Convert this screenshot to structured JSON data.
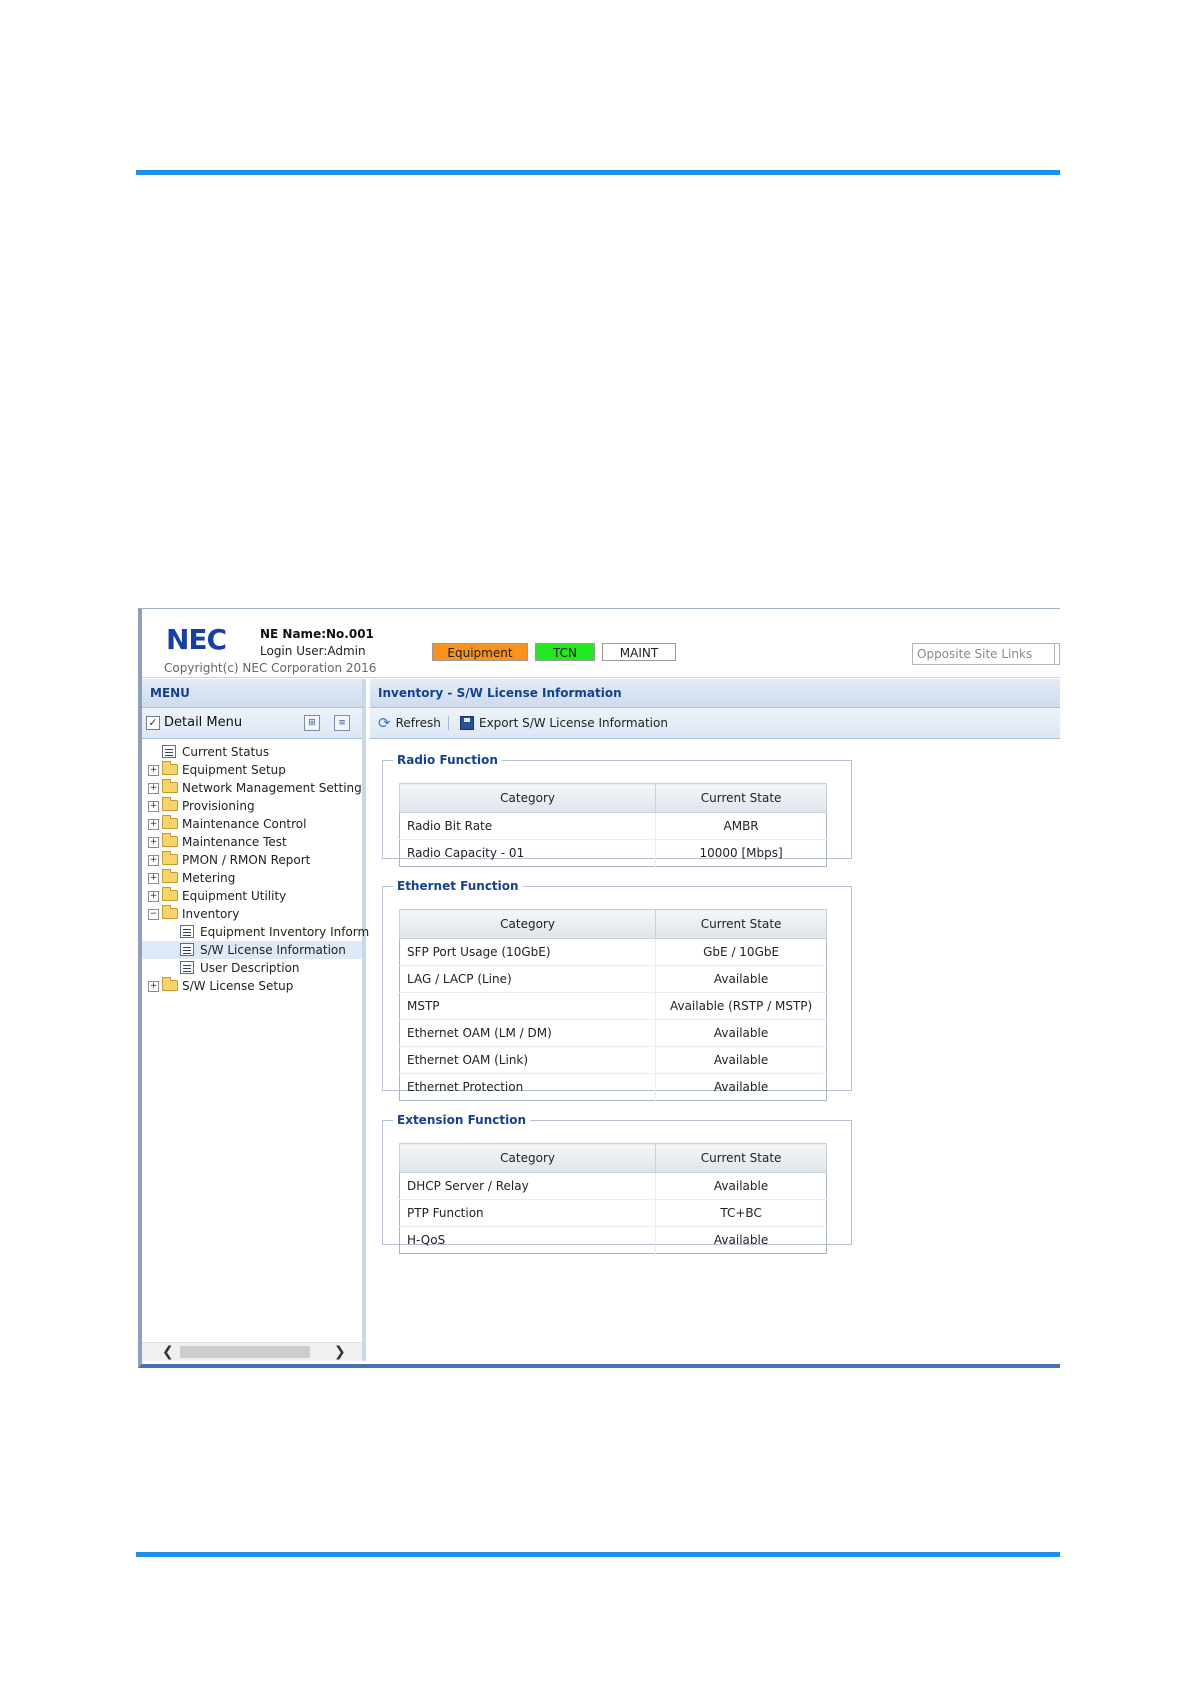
{
  "app": {
    "logo": "NEC",
    "ne_name": "NE Name:No.001",
    "login_user": "Login User:Admin",
    "copyright": "Copyright(c) NEC Corporation 2016",
    "status_buttons": [
      {
        "label": "Equipment",
        "color": "#f7931e"
      },
      {
        "label": "TCN",
        "color": "#22e822"
      },
      {
        "label": "MAINT",
        "color": "#ffffff"
      }
    ],
    "opposite_site_links": "Opposite Site Links"
  },
  "menu": {
    "title": "MENU",
    "detail_menu_label": "Detail Menu",
    "detail_menu_checked": true,
    "items": [
      {
        "label": "Current Status",
        "type": "leaf",
        "level": 0
      },
      {
        "label": "Equipment Setup",
        "type": "folder",
        "level": 0,
        "expander": "+"
      },
      {
        "label": "Network Management Setting",
        "type": "folder",
        "level": 0,
        "expander": "+"
      },
      {
        "label": "Provisioning",
        "type": "folder",
        "level": 0,
        "expander": "+"
      },
      {
        "label": "Maintenance Control",
        "type": "folder",
        "level": 0,
        "expander": "+"
      },
      {
        "label": "Maintenance Test",
        "type": "folder",
        "level": 0,
        "expander": "+"
      },
      {
        "label": "PMON / RMON Report",
        "type": "folder",
        "level": 0,
        "expander": "+"
      },
      {
        "label": "Metering",
        "type": "folder",
        "level": 0,
        "expander": "+"
      },
      {
        "label": "Equipment Utility",
        "type": "folder",
        "level": 0,
        "expander": "+"
      },
      {
        "label": "Inventory",
        "type": "folder",
        "level": 0,
        "expander": "−"
      },
      {
        "label": "Equipment Inventory Informat",
        "type": "leaf",
        "level": 1
      },
      {
        "label": "S/W License Information",
        "type": "leaf",
        "level": 1,
        "selected": true
      },
      {
        "label": "User Description",
        "type": "leaf",
        "level": 1
      },
      {
        "label": "S/W License Setup",
        "type": "folder",
        "level": 0,
        "expander": "+"
      }
    ]
  },
  "content": {
    "title": "Inventory - S/W License Information",
    "toolbar": {
      "refresh_label": "Refresh",
      "export_label": "Export S/W License Information"
    },
    "sections": {
      "radio": {
        "legend": "Radio Function",
        "headers": [
          "Category",
          "Current State"
        ],
        "rows": [
          [
            "Radio Bit Rate",
            "AMBR"
          ],
          [
            "Radio Capacity - 01",
            "10000 [Mbps]"
          ]
        ]
      },
      "ethernet": {
        "legend": "Ethernet Function",
        "headers": [
          "Category",
          "Current State"
        ],
        "rows": [
          [
            "SFP Port Usage (10GbE)",
            "GbE / 10GbE"
          ],
          [
            "LAG / LACP (Line)",
            "Available"
          ],
          [
            "MSTP",
            "Available (RSTP / MSTP)"
          ],
          [
            "Ethernet OAM (LM / DM)",
            "Available"
          ],
          [
            "Ethernet OAM (Link)",
            "Available"
          ],
          [
            "Ethernet Protection",
            "Available"
          ]
        ]
      },
      "extension": {
        "legend": "Extension Function",
        "headers": [
          "Category",
          "Current State"
        ],
        "rows": [
          [
            "DHCP Server / Relay",
            "Available"
          ],
          [
            "PTP Function",
            "TC+BC"
          ],
          [
            "H-QoS",
            "Available"
          ]
        ]
      }
    }
  }
}
